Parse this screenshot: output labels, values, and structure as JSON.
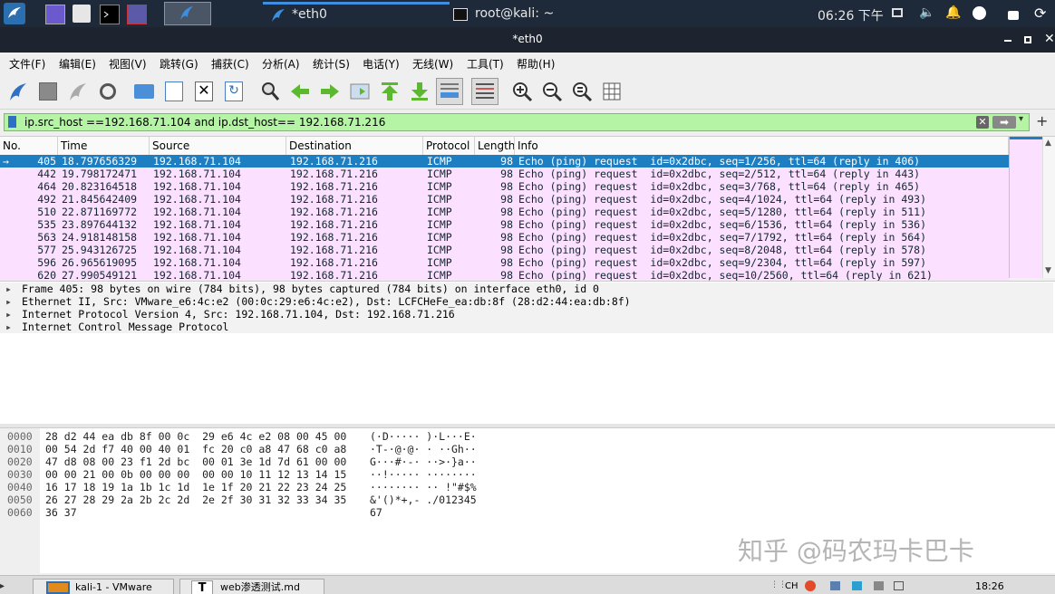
{
  "panel": {
    "task_capture": "*eth0",
    "task_terminal": "root@kali: ~",
    "clock": "06:26 下午"
  },
  "window": {
    "title": "*eth0"
  },
  "menu": [
    "文件(F)",
    "编辑(E)",
    "视图(V)",
    "跳转(G)",
    "捕获(C)",
    "分析(A)",
    "统计(S)",
    "电话(Y)",
    "无线(W)",
    "工具(T)",
    "帮助(H)"
  ],
  "filter": {
    "value": "ip.src_host ==192.168.71.104 and ip.dst_host== 192.168.71.216"
  },
  "columns": [
    "No.",
    "Time",
    "Source",
    "Destination",
    "Protocol",
    "Length",
    "Info"
  ],
  "packets": [
    {
      "no": "405",
      "time": "18.797656329",
      "src": "192.168.71.104",
      "dst": "192.168.71.216",
      "proto": "ICMP",
      "len": "98",
      "info": "Echo (ping) request  id=0x2dbc, seq=1/256, ttl=64 (reply in 406)"
    },
    {
      "no": "442",
      "time": "19.798172471",
      "src": "192.168.71.104",
      "dst": "192.168.71.216",
      "proto": "ICMP",
      "len": "98",
      "info": "Echo (ping) request  id=0x2dbc, seq=2/512, ttl=64 (reply in 443)"
    },
    {
      "no": "464",
      "time": "20.823164518",
      "src": "192.168.71.104",
      "dst": "192.168.71.216",
      "proto": "ICMP",
      "len": "98",
      "info": "Echo (ping) request  id=0x2dbc, seq=3/768, ttl=64 (reply in 465)"
    },
    {
      "no": "492",
      "time": "21.845642409",
      "src": "192.168.71.104",
      "dst": "192.168.71.216",
      "proto": "ICMP",
      "len": "98",
      "info": "Echo (ping) request  id=0x2dbc, seq=4/1024, ttl=64 (reply in 493)"
    },
    {
      "no": "510",
      "time": "22.871169772",
      "src": "192.168.71.104",
      "dst": "192.168.71.216",
      "proto": "ICMP",
      "len": "98",
      "info": "Echo (ping) request  id=0x2dbc, seq=5/1280, ttl=64 (reply in 511)"
    },
    {
      "no": "535",
      "time": "23.897644132",
      "src": "192.168.71.104",
      "dst": "192.168.71.216",
      "proto": "ICMP",
      "len": "98",
      "info": "Echo (ping) request  id=0x2dbc, seq=6/1536, ttl=64 (reply in 536)"
    },
    {
      "no": "563",
      "time": "24.918148158",
      "src": "192.168.71.104",
      "dst": "192.168.71.216",
      "proto": "ICMP",
      "len": "98",
      "info": "Echo (ping) request  id=0x2dbc, seq=7/1792, ttl=64 (reply in 564)"
    },
    {
      "no": "577",
      "time": "25.943126725",
      "src": "192.168.71.104",
      "dst": "192.168.71.216",
      "proto": "ICMP",
      "len": "98",
      "info": "Echo (ping) request  id=0x2dbc, seq=8/2048, ttl=64 (reply in 578)"
    },
    {
      "no": "596",
      "time": "26.965619095",
      "src": "192.168.71.104",
      "dst": "192.168.71.216",
      "proto": "ICMP",
      "len": "98",
      "info": "Echo (ping) request  id=0x2dbc, seq=9/2304, ttl=64 (reply in 597)"
    },
    {
      "no": "620",
      "time": "27.990549121",
      "src": "192.168.71.104",
      "dst": "192.168.71.216",
      "proto": "ICMP",
      "len": "98",
      "info": "Echo (ping) request  id=0x2dbc, seq=10/2560, ttl=64 (reply in 621)"
    }
  ],
  "details": [
    "Frame 405: 98 bytes on wire (784 bits), 98 bytes captured (784 bits) on interface eth0, id 0",
    "Ethernet II, Src: VMware_e6:4c:e2 (00:0c:29:e6:4c:e2), Dst: LCFCHeFe_ea:db:8f (28:d2:44:ea:db:8f)",
    "Internet Protocol Version 4, Src: 192.168.71.104, Dst: 192.168.71.216",
    "Internet Control Message Protocol"
  ],
  "bytes": [
    {
      "off": "0000",
      "hex": "28 d2 44 ea db 8f 00 0c  29 e6 4c e2 08 00 45 00",
      "ascii": "(·D····· )·L···E·"
    },
    {
      "off": "0010",
      "hex": "00 54 2d f7 40 00 40 01  fc 20 c0 a8 47 68 c0 a8",
      "ascii": "·T-·@·@· · ··Gh··"
    },
    {
      "off": "0020",
      "hex": "47 d8 08 00 23 f1 2d bc  00 01 3e 1d 7d 61 00 00",
      "ascii": "G···#·-· ··>·}a··"
    },
    {
      "off": "0030",
      "hex": "00 00 21 00 0b 00 00 00  00 00 10 11 12 13 14 15",
      "ascii": "··!····· ········"
    },
    {
      "off": "0040",
      "hex": "16 17 18 19 1a 1b 1c 1d  1e 1f 20 21 22 23 24 25",
      "ascii": "········ ·· !\"#$%"
    },
    {
      "off": "0050",
      "hex": "26 27 28 29 2a 2b 2c 2d  2e 2f 30 31 32 33 34 35",
      "ascii": "&'()*+,- ./012345"
    },
    {
      "off": "0060",
      "hex": "36 37",
      "ascii": "67"
    }
  ],
  "watermark": "知乎 @码农玛卡巴卡",
  "taskbar": {
    "task1": "kali-1 - VMware",
    "task2": "web渗透测试.md",
    "clock": "18:26"
  },
  "colors": {
    "selected_row": "#1d7ec2",
    "icmp_row": "#fce0ff",
    "filter_bg": "#b4f4a4",
    "panel": "#1e2a3a"
  }
}
